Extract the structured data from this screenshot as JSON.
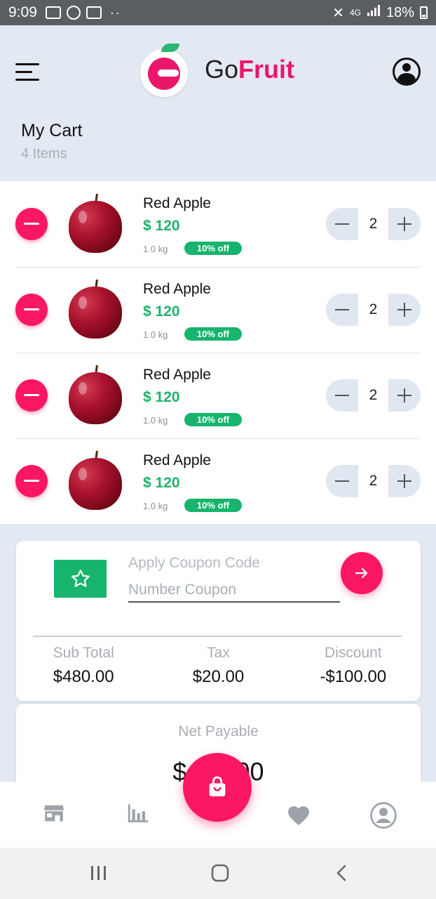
{
  "status_bar": {
    "time": "9:09",
    "network": "4G",
    "battery": "18%"
  },
  "header": {
    "brand_go": "Go",
    "brand_fruit": "Fruit",
    "menu_icon": "menu-icon",
    "account_icon": "account-icon"
  },
  "cart": {
    "title": "My Cart",
    "count": "4 Items",
    "items": [
      {
        "name": "Red Apple",
        "price": "$ 120",
        "weight": "1.0 kg",
        "discount": "10% off",
        "qty": "2"
      },
      {
        "name": "Red Apple",
        "price": "$ 120",
        "weight": "1.0 kg",
        "discount": "10% off",
        "qty": "2"
      },
      {
        "name": "Red Apple",
        "price": "$ 120",
        "weight": "1.0 kg",
        "discount": "10% off",
        "qty": "2"
      },
      {
        "name": "Red Apple",
        "price": "$ 120",
        "weight": "1.0 kg",
        "discount": "10% off",
        "qty": "2"
      }
    ]
  },
  "coupon": {
    "label": "Apply Coupon Code",
    "placeholder": "Number Coupon",
    "value": ""
  },
  "totals": {
    "sub_total_label": "Sub Total",
    "sub_total": "$480.00",
    "tax_label": "Tax",
    "tax": "$20.00",
    "discount_label": "Discount",
    "discount": "-$100.00"
  },
  "net": {
    "label": "Net Payable",
    "value": "$400.00"
  },
  "bottom_nav": [
    "store-icon",
    "chart-icon",
    "cart-bag-icon",
    "heart-icon",
    "profile-icon"
  ],
  "colors": {
    "accent": "#fb1763",
    "green": "#16b46c",
    "background": "#e3e9f2"
  }
}
